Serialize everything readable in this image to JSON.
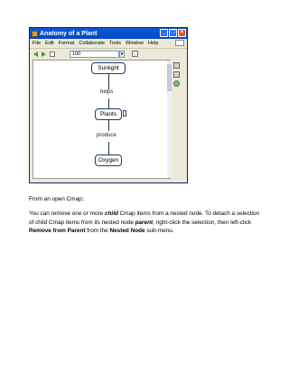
{
  "window": {
    "title": "Anatomy of a Plant",
    "menu": [
      "File",
      "Edit",
      "Format",
      "Collaborate",
      "Tools",
      "Window",
      "Help"
    ],
    "zoom_value": "100"
  },
  "cmap": {
    "nodes": {
      "sunlight": "Sunlight",
      "plants": "Plants",
      "oxygen": "Oxygen"
    },
    "links": {
      "helps": "helps",
      "produce": "produce"
    }
  },
  "doc": {
    "heading_prefix": "From an open Cmap",
    "heading_suffix": ":",
    "para": {
      "t1": "You can remove one or more ",
      "t2": "child",
      "t3": " Cmap items from a nested node. To detach a selection of child Cmap items from its nested node ",
      "t4": "parent",
      "t5": ", right-click the selection, then left-click ",
      "t6": "Remove from Parent",
      "t7": " from the ",
      "t8": "Nested Node",
      "t9": " sub-menu."
    }
  },
  "colors": {
    "titlebar": "#0a5ad9",
    "node_border": "#1b3b6e",
    "window_bg": "#ece9d8"
  },
  "icons": [
    "app-icon",
    "minimize-icon",
    "maximize-icon",
    "close-icon",
    "back-arrow-icon",
    "forward-arrow-icon",
    "nested-node-icon"
  ]
}
